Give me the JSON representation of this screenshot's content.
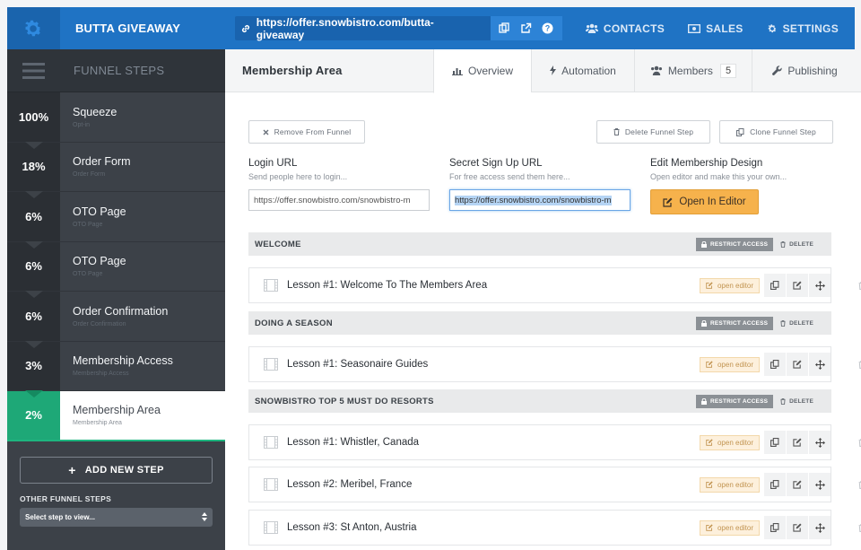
{
  "app": {
    "title": "BUTTA GIVEAWAY",
    "url": "https://offer.snowbistro.com/butta-giveaway"
  },
  "topnav": [
    {
      "label": "CONTACTS",
      "icon": "users-icon"
    },
    {
      "label": "SALES",
      "icon": "money-icon"
    },
    {
      "label": "SETTINGS",
      "icon": "gear-icon"
    }
  ],
  "sidebar": {
    "header": "FUNNEL STEPS",
    "steps": [
      {
        "pct": "100%",
        "name": "Squeeze",
        "sub": "Opt-in"
      },
      {
        "pct": "18%",
        "name": "Order Form",
        "sub": "Order Form"
      },
      {
        "pct": "6%",
        "name": "OTO Page",
        "sub": "OTO Page"
      },
      {
        "pct": "6%",
        "name": "OTO Page",
        "sub": "OTO Page"
      },
      {
        "pct": "6%",
        "name": "Order Confirmation",
        "sub": "Order Confirmation"
      },
      {
        "pct": "3%",
        "name": "Membership Access",
        "sub": "Membership Access"
      },
      {
        "pct": "2%",
        "name": "Membership Area",
        "sub": "Membership Area"
      }
    ],
    "add_step": "ADD NEW STEP",
    "other_label": "OTHER FUNNEL STEPS",
    "select_placeholder": "Select step to view..."
  },
  "main": {
    "title": "Membership Area",
    "tabs": [
      {
        "label": "Overview",
        "icon": "chart-icon"
      },
      {
        "label": "Automation",
        "icon": "bolt-icon"
      },
      {
        "label": "Members",
        "icon": "users-icon",
        "count": "5"
      },
      {
        "label": "Publishing",
        "icon": "wrench-icon"
      }
    ],
    "remove_btn": "Remove From Funnel",
    "delete_btn": "Delete Funnel Step",
    "clone_btn": "Clone Funnel Step",
    "login": {
      "title": "Login URL",
      "help": "Send people here to login...",
      "value": "https://offer.snowbistro.com/snowbistro-m"
    },
    "signup": {
      "title": "Secret Sign Up URL",
      "help": "For free access send them here...",
      "value": "https://offer.snowbistro.com/snowbistro-m"
    },
    "design": {
      "title": "Edit Membership Design",
      "help": "Open editor and make this your own...",
      "button": "Open In Editor"
    },
    "restrict_label": "RESTRICT ACCESS",
    "delete_label": "DELETE",
    "open_editor_label": "open editor",
    "sections": [
      {
        "title": "WELCOME",
        "lessons": [
          "Lesson #1: Welcome To The Members Area"
        ]
      },
      {
        "title": "DOING A SEASON",
        "lessons": [
          "Lesson #1: Seasonaire Guides"
        ]
      },
      {
        "title": "SNOWBISTRO TOP 5 MUST DO RESORTS",
        "lessons": [
          "Lesson #1: Whistler, Canada",
          "Lesson #2: Meribel, France",
          "Lesson #3: St Anton, Austria"
        ]
      }
    ]
  },
  "colors": {
    "brand_blue": "#1f73c4",
    "sidebar_dark": "#3c4148",
    "active_green": "#1ea877",
    "editor_orange": "#f6b24c"
  }
}
